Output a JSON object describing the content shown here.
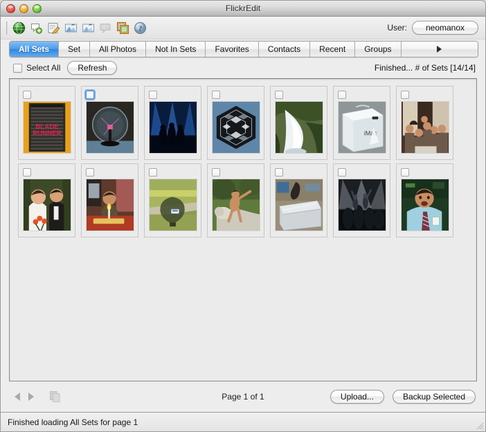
{
  "window": {
    "title": "FlickrEdit",
    "controls": [
      {
        "name": "close",
        "color": "#e0463c"
      },
      {
        "name": "minimize",
        "color": "#f0a42a"
      },
      {
        "name": "zoom",
        "color": "#62bf34"
      }
    ]
  },
  "toolbar": {
    "icons": [
      {
        "name": "globe-icon",
        "label": "Browse"
      },
      {
        "name": "add-comment-icon",
        "label": "Add Comment"
      },
      {
        "name": "edit-icon",
        "label": "Edit"
      },
      {
        "name": "upload-photo-icon",
        "label": "Upload"
      },
      {
        "name": "download-photo-icon",
        "label": "Download"
      },
      {
        "name": "comment-disabled-icon",
        "label": "Comment"
      },
      {
        "name": "photos-icon",
        "label": "Photos"
      },
      {
        "name": "help-icon",
        "label": "Help"
      }
    ],
    "user_label": "User:",
    "user_name": "neomanox"
  },
  "tabs": {
    "items": [
      {
        "label": "All Sets",
        "active": true
      },
      {
        "label": "Set",
        "active": false
      },
      {
        "label": "All Photos",
        "active": false
      },
      {
        "label": "Not In Sets",
        "active": false
      },
      {
        "label": "Favorites",
        "active": false
      },
      {
        "label": "Contacts",
        "active": false
      },
      {
        "label": "Recent",
        "active": false
      },
      {
        "label": "Groups",
        "active": false
      }
    ],
    "overflow_icon": "chevron-right-icon"
  },
  "controls": {
    "select_all_label": "Select All",
    "refresh_label": "Refresh",
    "status_count": "Finished... # of Sets [14/14]"
  },
  "grid": {
    "cells": [
      {
        "name": "blade-runner-poster",
        "focused": false,
        "checked": false
      },
      {
        "name": "plasma-globe",
        "focused": true,
        "checked": false
      },
      {
        "name": "concert-blue-stage",
        "focused": false,
        "checked": false
      },
      {
        "name": "hexagon-mosaic-tile",
        "focused": false,
        "checked": false
      },
      {
        "name": "waterfall-landscape",
        "focused": false,
        "checked": false
      },
      {
        "name": "imac-box",
        "focused": false,
        "checked": false
      },
      {
        "name": "group-party-photo",
        "focused": false,
        "checked": false
      },
      {
        "name": "wedding-couple",
        "focused": false,
        "checked": false
      },
      {
        "name": "birthday-candle",
        "focused": false,
        "checked": false
      },
      {
        "name": "balloon-shadow-field",
        "focused": false,
        "checked": false
      },
      {
        "name": "lion-statue",
        "focused": false,
        "checked": false
      },
      {
        "name": "metal-case",
        "focused": false,
        "checked": false
      },
      {
        "name": "concert-smoke-stage",
        "focused": false,
        "checked": false
      },
      {
        "name": "man-in-blue-shirt",
        "focused": false,
        "checked": false
      }
    ]
  },
  "bottom": {
    "prev_icon": "triangle-left-icon",
    "next_icon": "triangle-right-icon",
    "copy_icon": "copy-pages-icon",
    "page_indicator": "Page 1 of 1",
    "upload_label": "Upload...",
    "backup_label": "Backup Selected"
  },
  "statusbar": {
    "message": "Finished loading All Sets for page 1",
    "resizer_icon": "resize-grip-icon"
  },
  "colors": {
    "accent": "#2f87df",
    "window_bg": "#ededed",
    "panel_bg": "#ebebeb",
    "focus_ring": "#5496df"
  }
}
